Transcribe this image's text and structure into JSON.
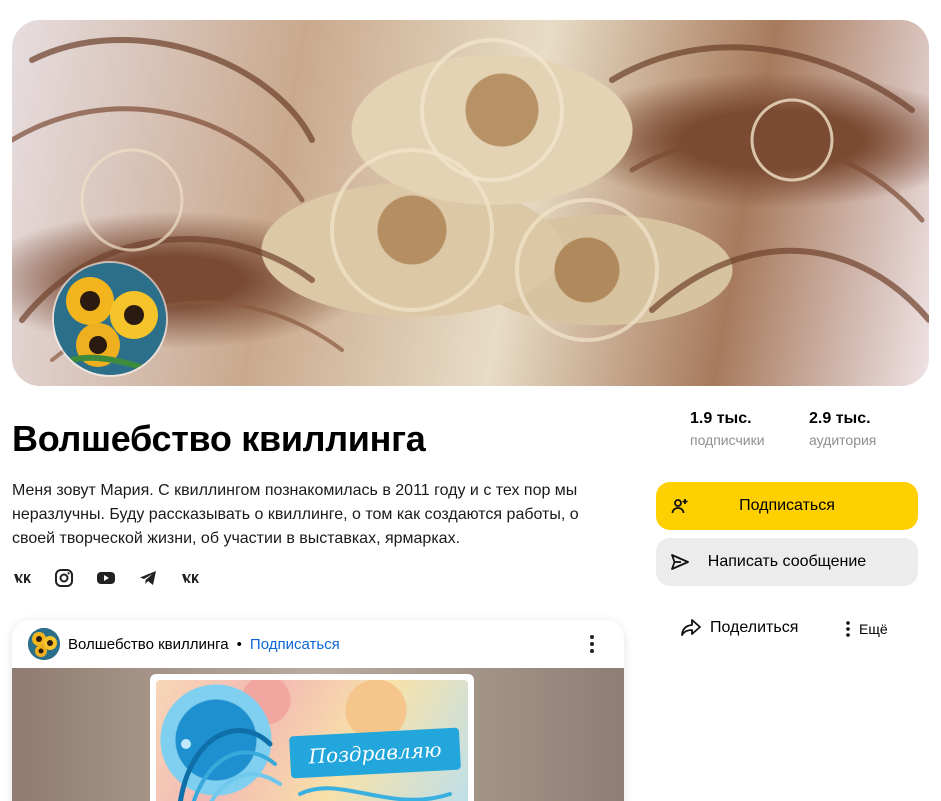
{
  "channel": {
    "title": "Волшебство квиллинга",
    "description": "Меня зовут Мария. С квиллингом познакомилась в 2011 году и с тех пор мы неразлучны. Буду рассказывать о квиллинге, о том как создаются работы, о своей творческой жизни, об участии в выставках, ярмарках."
  },
  "stats": {
    "subscribers": {
      "value": "1.9 тыс.",
      "label": "подписчики"
    },
    "audience": {
      "value": "2.9 тыс.",
      "label": "аудитория"
    }
  },
  "actions": {
    "subscribe_label": "Подписаться",
    "message_label": "Написать сообщение",
    "share_label": "Поделиться",
    "more_label": "Ещё"
  },
  "socials": [
    "vk-icon",
    "instagram-icon",
    "youtube-icon",
    "telegram-icon",
    "vk-icon"
  ],
  "post": {
    "channel_name": "Волшебство квиллинга",
    "separator": " • ",
    "subscribe_link": "Подписаться",
    "image_text": "Поздравляю"
  },
  "colors": {
    "accent_yellow": "#ffd000",
    "secondary_button": "#ececec",
    "link_blue": "#0a66d8",
    "muted_text": "#8f8f8f"
  }
}
